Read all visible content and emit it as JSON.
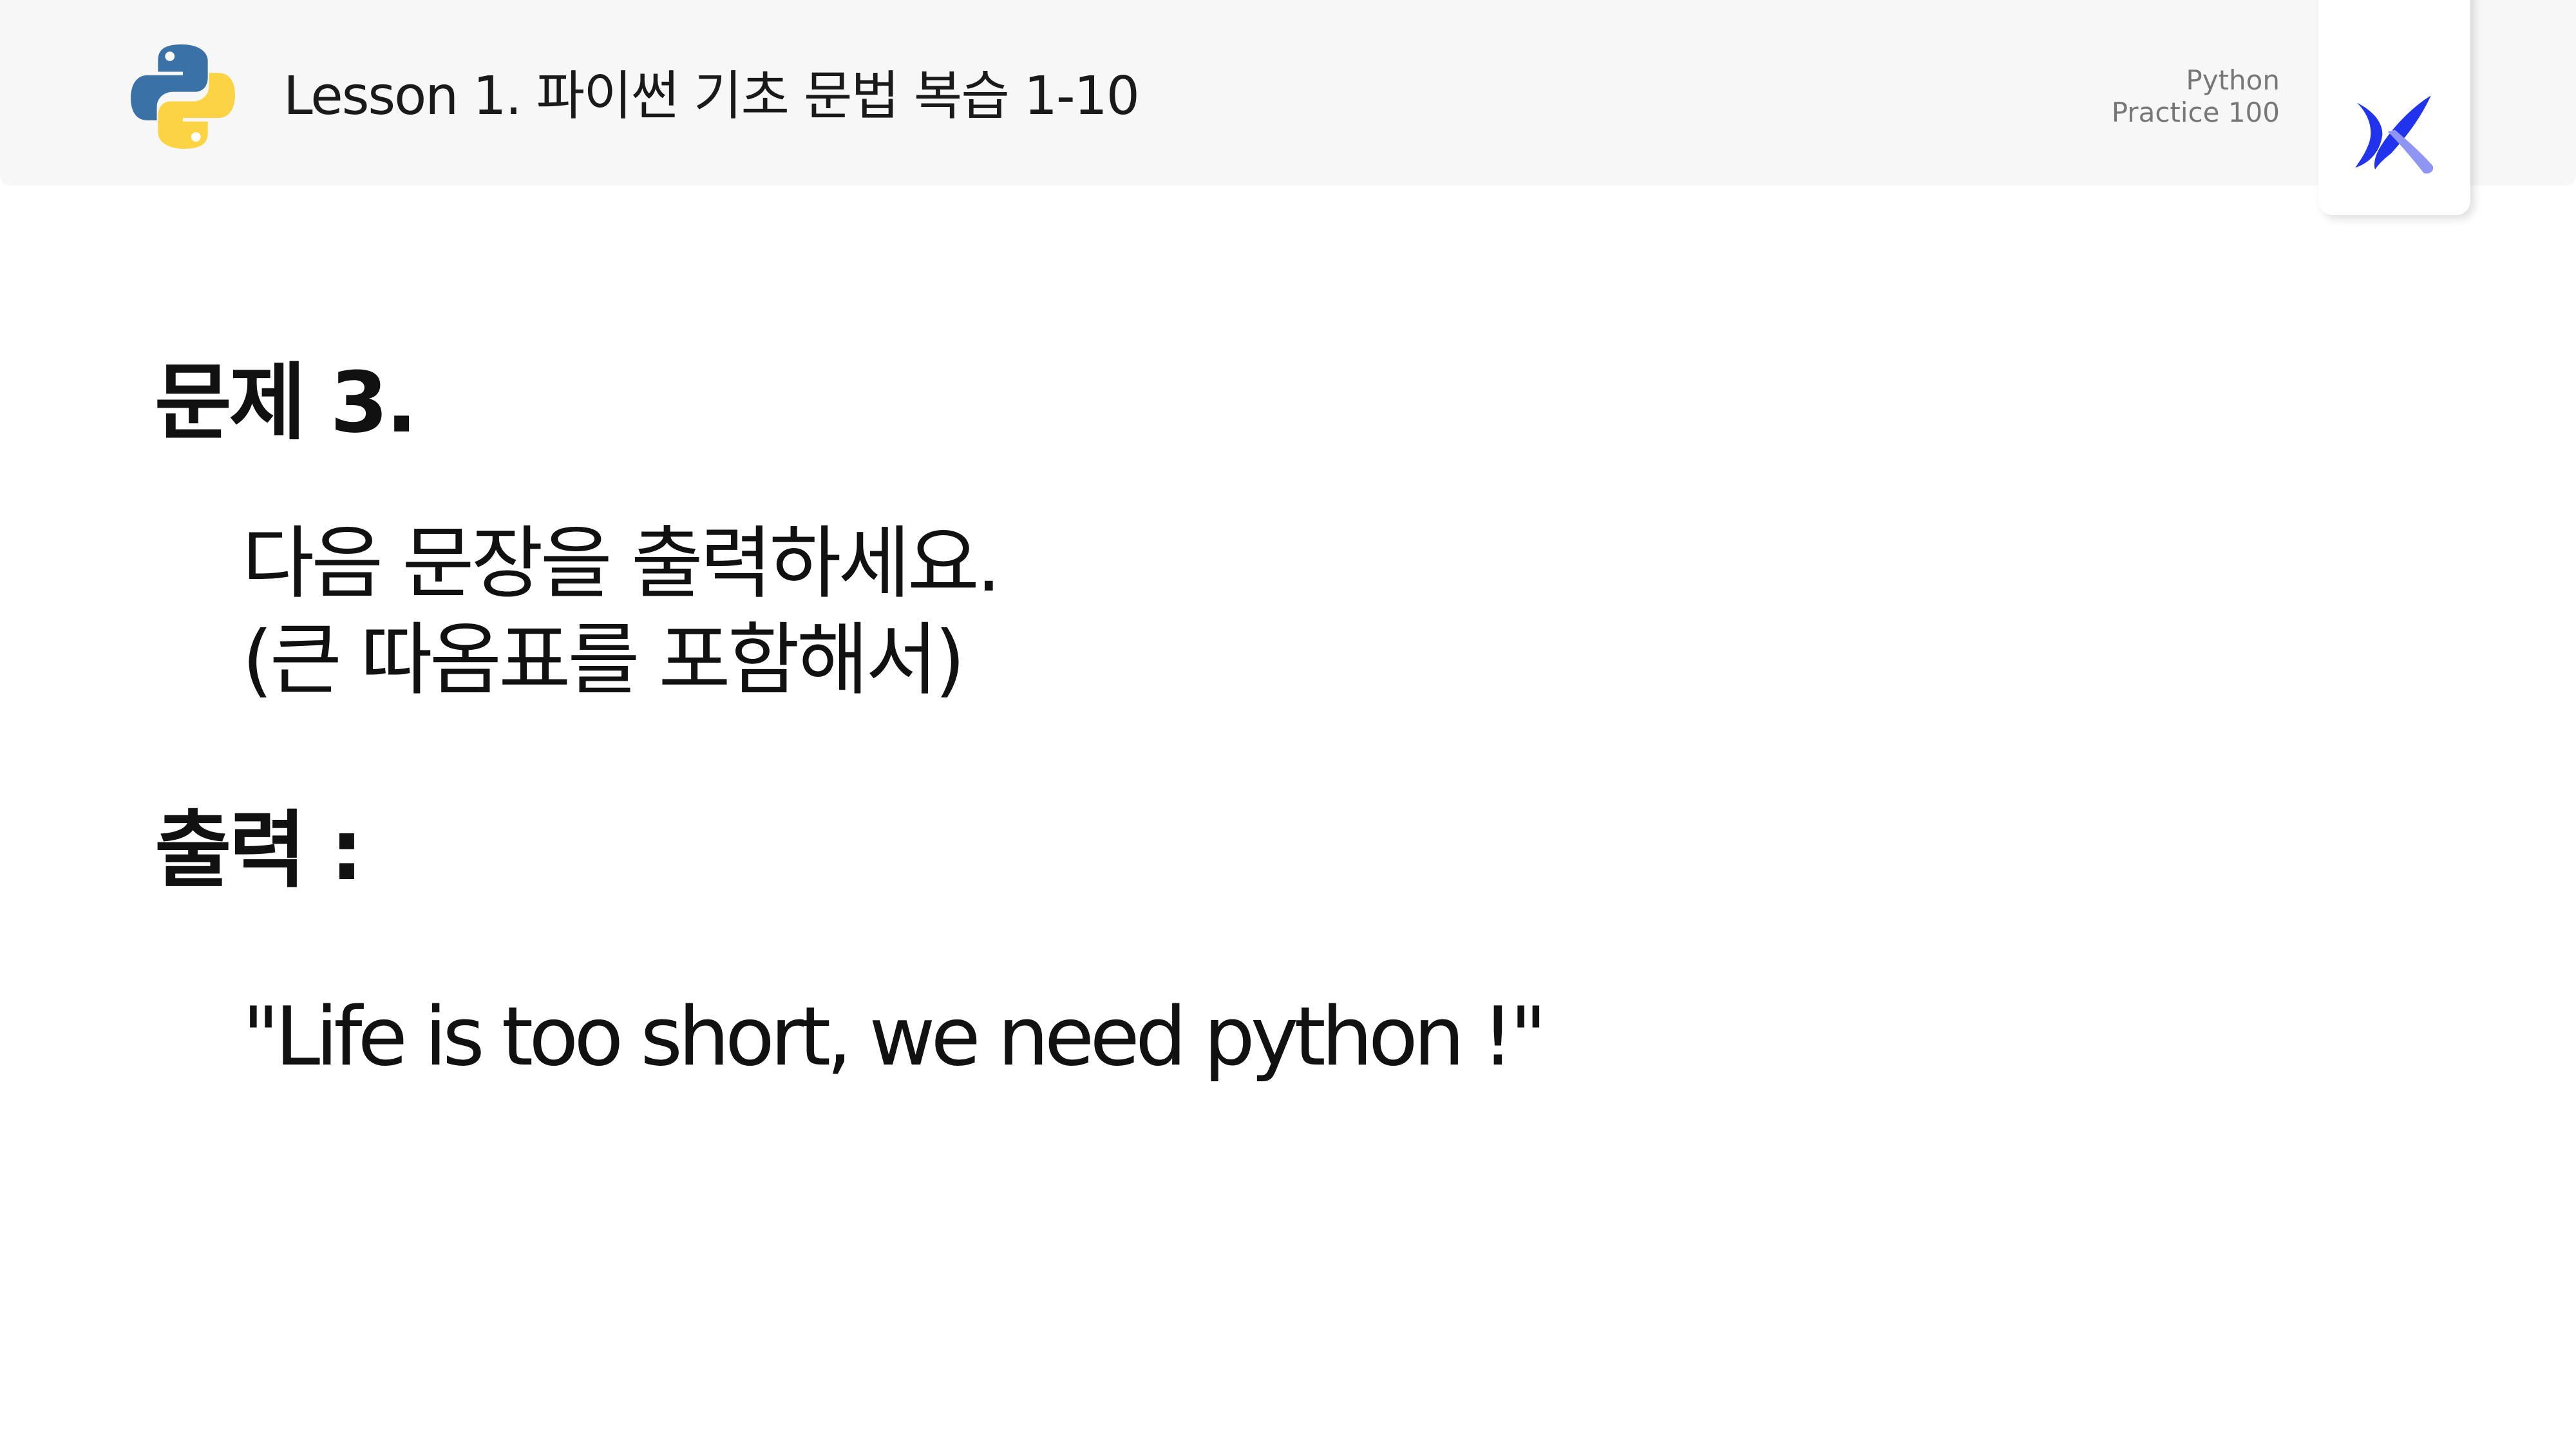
{
  "header": {
    "title": "Lesson 1. 파이썬 기초 문법 복습 1-10",
    "course_line1": "Python",
    "course_line2": "Practice 100"
  },
  "problem": {
    "heading": "문제 3.",
    "question_line1": "다음 문장을 출력하세요.",
    "question_line2": "(큰 따옴표를 포함해서)"
  },
  "output": {
    "heading": "출력 :",
    "text": "\"Life is too short, we need python !\""
  },
  "icons": {
    "python_logo": "python-logo-icon",
    "brand_logo": "brand-x-logo-icon"
  },
  "colors": {
    "header_bg": "#f7f7f7",
    "python_blue": "#3a72a8",
    "python_yellow": "#fcd343",
    "brand_blue": "#2233ee",
    "brand_light": "#8f95f2"
  }
}
